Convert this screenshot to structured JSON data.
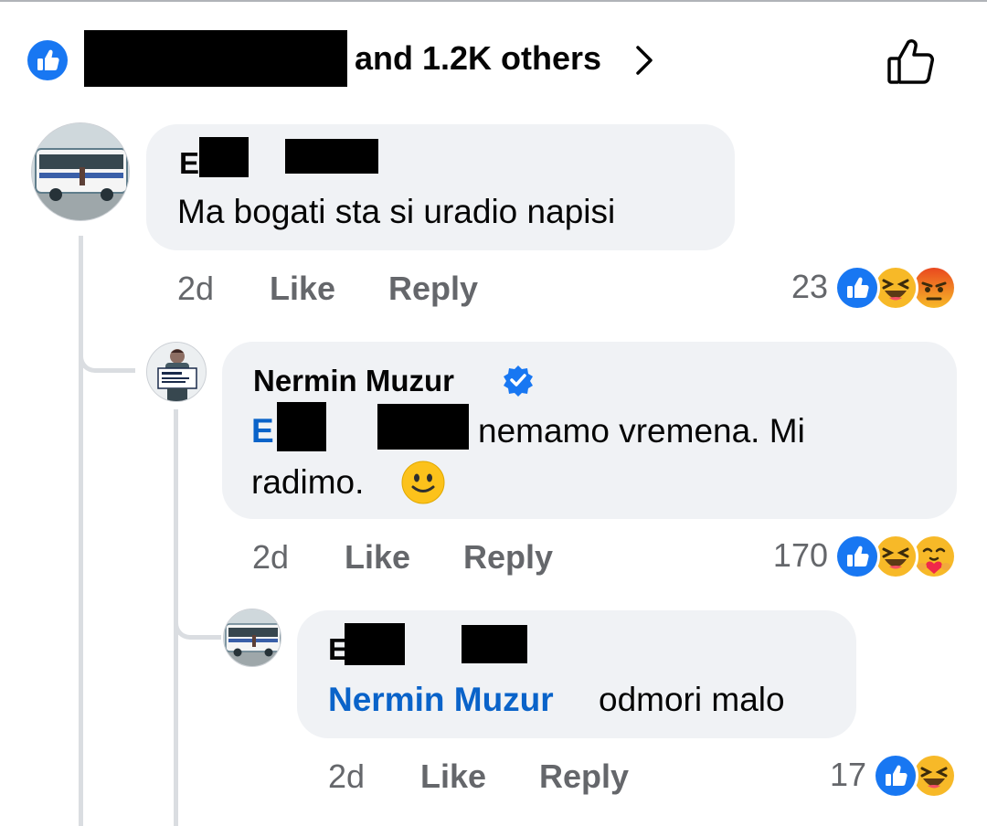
{
  "summary": {
    "others_text": "and 1.2K others",
    "chevron": "chevron-right-icon",
    "like_icon": "thumbs-up-outline-icon"
  },
  "comments": [
    {
      "author": "E     Ad",
      "text": "Ma bogati sta si uradio napisi",
      "time": "2d",
      "like_label": "Like",
      "reply_label": "Reply",
      "reaction_count": "23",
      "reactions": [
        "like-reaction-icon",
        "haha-reaction-icon",
        "angry-reaction-icon"
      ],
      "avatar": "bus-photo-avatar"
    },
    {
      "author": "Nermin Muzur",
      "verified": true,
      "mention": "E     Ad",
      "text": "nemamo vremena. Mi",
      "text_line2": "radimo.",
      "emoji": "slightly-smiling-face",
      "time": "2d",
      "like_label": "Like",
      "reply_label": "Reply",
      "reaction_count": "170",
      "reactions": [
        "like-reaction-icon",
        "haha-reaction-icon",
        "care-reaction-icon"
      ],
      "avatar": "man-holding-sign-avatar",
      "avatar_sign_text": "Mi radimo."
    },
    {
      "author": "E     Ad",
      "mention": "Nermin Muzur",
      "text": "odmori malo",
      "time": "2d",
      "like_label": "Like",
      "reply_label": "Reply",
      "reaction_count": "17",
      "reactions": [
        "like-reaction-icon",
        "haha-reaction-icon"
      ],
      "avatar": "bus-photo-avatar"
    }
  ],
  "colors": {
    "link_blue": "#0a63c9",
    "fb_blue": "#1877f2",
    "bubble_bg": "#f0f2f5",
    "meta_gray": "#65676b"
  }
}
